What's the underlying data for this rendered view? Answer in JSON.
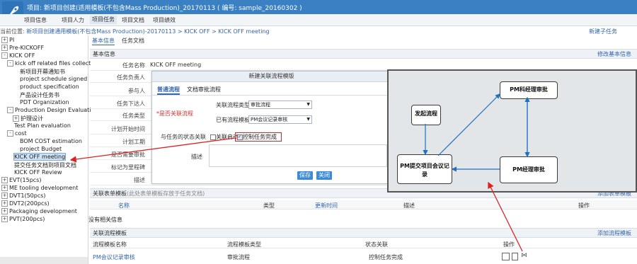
{
  "header": {
    "title": "项目: 新项目创建(适用模板(不包含Mass Production)_20170113 ( 编号: sample_20160302 )",
    "nav_tabs": [
      "项目信息",
      "项目人力",
      "项目任务",
      "项目文档",
      "项目绩效"
    ],
    "active_tab": "项目任务"
  },
  "breadcrumb": {
    "label": "当前位置:",
    "path": "新项目创建通用模板(不包含Mass Production)-20170113 > KICK OFF > KICK OFF meeting",
    "new_task": "新建子任务"
  },
  "tree": [
    {
      "label": "PI",
      "toggle": "+"
    },
    {
      "label": "Pre-KICKOFF",
      "toggle": "+"
    },
    {
      "label": "KICK OFF",
      "toggle": "-"
    },
    {
      "label": "kick off related files collect",
      "toggle": "-"
    },
    {
      "label": "新项目开幕通知书",
      "toggle": ""
    },
    {
      "label": "project schedule signed",
      "toggle": ""
    },
    {
      "label": "product specification",
      "toggle": ""
    },
    {
      "label": "产品设计任务书",
      "toggle": ""
    },
    {
      "label": "PDT Organization",
      "toggle": ""
    },
    {
      "label": "Production Design Evaluati",
      "toggle": "-"
    },
    {
      "label": "护理设计",
      "toggle": "+"
    },
    {
      "label": "Test Plan evaluation",
      "toggle": ""
    },
    {
      "label": "cost",
      "toggle": "-"
    },
    {
      "label": "BOM COST estimation",
      "toggle": ""
    },
    {
      "label": "project Budget",
      "toggle": ""
    },
    {
      "label": "KICK OFF meeting",
      "toggle": ""
    },
    {
      "label": "提交任务文档到项目文档",
      "toggle": ""
    },
    {
      "label": "KICK OFF Review",
      "toggle": ""
    },
    {
      "label": "EVT(15pcs)",
      "toggle": "+"
    },
    {
      "label": "ME tooling development",
      "toggle": "+"
    },
    {
      "label": "DVT1(50pcs)",
      "toggle": "+"
    },
    {
      "label": "DVT2(200pcs)",
      "toggle": "+"
    },
    {
      "label": "Packaging development",
      "toggle": "+"
    },
    {
      "label": "PVT(200pcs)",
      "toggle": "+"
    }
  ],
  "main": {
    "subtabs": [
      "基本信息",
      "任务文档"
    ],
    "basic_section": {
      "title": "基本信息",
      "action": "修改基本信息"
    },
    "fields": [
      {
        "key": "任务名称",
        "value": "KICK OFF meeting"
      },
      {
        "key": "任务负责人",
        "value": ""
      },
      {
        "key": "参与人",
        "value": ""
      },
      {
        "key": "任务下达人",
        "value": ""
      },
      {
        "key": "任务类型",
        "value": ""
      },
      {
        "key": "计划开始时间",
        "value": ""
      },
      {
        "key": "计划工期",
        "value": ""
      },
      {
        "key": "是否需要审批",
        "value": ""
      },
      {
        "key": "标记为里程碑",
        "value": ""
      },
      {
        "key": "描述",
        "value": ""
      }
    ],
    "forms_section": {
      "title": "关联表单模板",
      "hint": "(此处表单模板存放于任务文档)",
      "action": "添加表单模板"
    },
    "forms_columns": [
      "名称",
      "类型",
      "更新时间",
      "描述",
      "操作"
    ],
    "forms_empty": "没有相关信息",
    "flow_section": {
      "title": "关联流程模板",
      "action": "添加流程模板"
    },
    "flow_columns": [
      "流程模板名称",
      "流程模板类型",
      "状态关联",
      "操作"
    ],
    "flow_rows": [
      {
        "name": "PM会议记录审核",
        "type": "审批流程",
        "status": "控制任务完成"
      }
    ]
  },
  "dialog": {
    "title": "新建关联流程模版",
    "tabs": [
      "普通流程",
      "文档审批流程"
    ],
    "flow_type_label": "关联流程类型",
    "flow_type_value": "审批流程",
    "template_label": "已有流程模板",
    "template_value": "PM会议记录审核",
    "required_label": "*是否关联流程",
    "task_status_label": "与任务的状态关联",
    "checkbox_1": "关联启动",
    "checkbox_2": "控制任务完成",
    "desc_label": "描述",
    "save": "保存",
    "close": "关闭"
  },
  "flow_diagram": {
    "nodes": [
      "发起流程",
      "PM科经理审批",
      "PM提交项目会议记录",
      "PM经理审批"
    ]
  },
  "colors": {
    "topbar": "#3a80c2",
    "link": "#3366aa",
    "annotation": "#dd2222",
    "button": "#3d8bd6"
  }
}
